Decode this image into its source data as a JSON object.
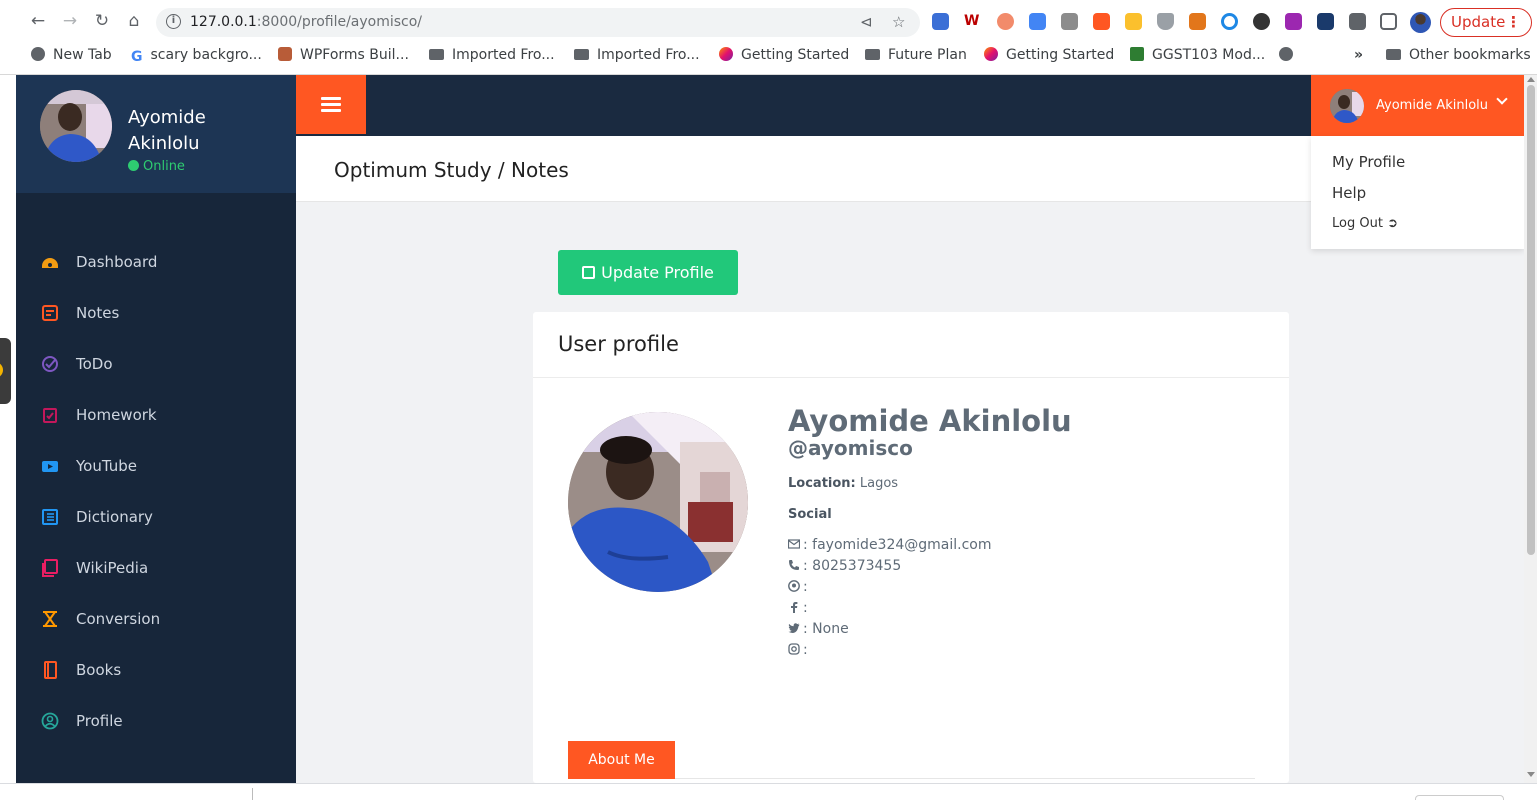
{
  "browser": {
    "url_host": "127.0.0.1",
    "url_rest": ":8000/profile/ayomisco/",
    "update_label": "Update",
    "bookmarks": [
      {
        "label": "New Tab",
        "icon": "globe-icon"
      },
      {
        "label": "scary backgro...",
        "icon": "google-icon"
      },
      {
        "label": "WPForms Buil...",
        "icon": "wpforms-icon"
      },
      {
        "label": "Imported Fro...",
        "icon": "folder-icon"
      },
      {
        "label": "Imported Fro...",
        "icon": "folder-icon"
      },
      {
        "label": "Getting Started",
        "icon": "firefox-icon"
      },
      {
        "label": "Future Plan",
        "icon": "folder-icon"
      },
      {
        "label": "Getting Started",
        "icon": "firefox-icon"
      },
      {
        "label": "GGST103 Mod...",
        "icon": "university-icon"
      }
    ],
    "overflow_label": "»",
    "other_bookmarks": "Other bookmarks"
  },
  "sidebar": {
    "user_name": "Ayomide Akinlolu",
    "status": "Online",
    "items": [
      {
        "label": "Dashboard",
        "icon": "dashboard-icon",
        "color": "#f39c12"
      },
      {
        "label": "Notes",
        "icon": "notes-icon",
        "color": "#ff5722"
      },
      {
        "label": "ToDo",
        "icon": "todo-icon",
        "color": "#7e57c2"
      },
      {
        "label": "Homework",
        "icon": "homework-icon",
        "color": "#c2185b"
      },
      {
        "label": "YouTube",
        "icon": "youtube-icon",
        "color": "#2196f3"
      },
      {
        "label": "Dictionary",
        "icon": "dictionary-icon",
        "color": "#2196f3"
      },
      {
        "label": "WikiPedia",
        "icon": "wikipedia-icon",
        "color": "#e91e63"
      },
      {
        "label": "Conversion",
        "icon": "conversion-icon",
        "color": "#ff9800"
      },
      {
        "label": "Books",
        "icon": "books-icon",
        "color": "#ff5722"
      },
      {
        "label": "Profile",
        "icon": "profile-icon",
        "color": "#26a69a"
      }
    ]
  },
  "topbar": {
    "user_name": "Ayomide Akinlolu",
    "accent": "#ff5722"
  },
  "dropdown": {
    "items": [
      "My Profile",
      "Help",
      "Log Out"
    ]
  },
  "page": {
    "title": "Optimum Study / Notes",
    "update_button": "Update Profile",
    "card_title": "User profile",
    "profile": {
      "name": "Ayomide Akinlolu",
      "handle": "@ayomisco",
      "location_label": "Location:",
      "location": "Lagos",
      "social_label": "Social",
      "email": ": fayomide324@gmail.com",
      "phone": ": 8025373455",
      "github": ":",
      "facebook": ":",
      "twitter": ": None",
      "instagram": ":"
    },
    "tab": "About Me"
  }
}
